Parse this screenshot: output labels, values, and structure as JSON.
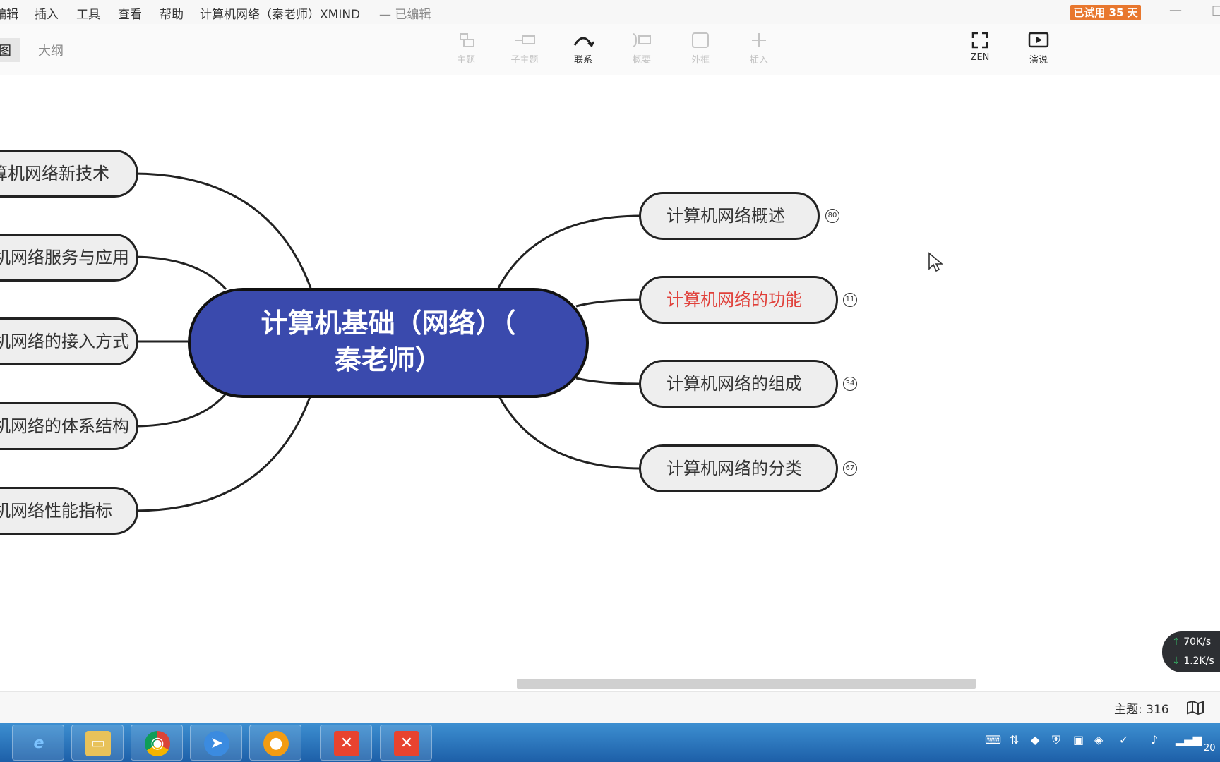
{
  "menubar": {
    "items": [
      "编辑",
      "插入",
      "工具",
      "查看",
      "帮助"
    ],
    "title": "计算机网络（秦老师）XMIND",
    "edited": "— 已编辑",
    "trial_badge": "已试用 35 天",
    "minimize": "—",
    "maximize": "□"
  },
  "toolbar": {
    "view_tabs": [
      "图",
      "大纲"
    ],
    "tools": [
      {
        "label": "主题",
        "icon": "topic-icon",
        "enabled": false
      },
      {
        "label": "子主题",
        "icon": "subtopic-icon",
        "enabled": false
      },
      {
        "label": "联系",
        "icon": "relationship-icon",
        "enabled": true
      },
      {
        "label": "概要",
        "icon": "summary-icon",
        "enabled": false
      },
      {
        "label": "外框",
        "icon": "boundary-icon",
        "enabled": false
      },
      {
        "label": "插入",
        "icon": "insert-plus-icon",
        "enabled": false
      }
    ],
    "right_tools": [
      {
        "label": "ZEN",
        "icon": "fullscreen-icon"
      },
      {
        "label": "演说",
        "icon": "present-icon"
      }
    ]
  },
  "mindmap": {
    "central": {
      "line1": "计算机基础（网络）（",
      "line2": "秦老师）",
      "color": "#3a4aad"
    },
    "left_topics": [
      "计算机网络新技术",
      "计算机网络服务与应用",
      "计算机网络的接入方式",
      "计算机网络的体系结构",
      "计算机网络性能指标"
    ],
    "right_topics": [
      {
        "label": "计算机网络概述",
        "count": "80",
        "color": "#333333"
      },
      {
        "label": "计算机网络的功能",
        "count": "11",
        "color": "#e0403a"
      },
      {
        "label": "计算机网络的组成",
        "count": "34",
        "color": "#333333"
      },
      {
        "label": "计算机网络的分类",
        "count": "67",
        "color": "#333333"
      }
    ]
  },
  "status": {
    "topic_count": "主题: 316"
  },
  "netmon": {
    "up": "70K/s",
    "down": "1.2K/s"
  },
  "taskbar": {
    "apps": [
      {
        "name": "ie-icon",
        "glyph": "e",
        "color": "#2a86d8"
      },
      {
        "name": "file-explorer-icon",
        "glyph": "▭",
        "color": "#e8c25a"
      },
      {
        "name": "chrome-icon",
        "glyph": "◉",
        "color": "#dd4b39"
      },
      {
        "name": "feishu-icon",
        "glyph": "➤",
        "color": "#3b8be0"
      },
      {
        "name": "record-icon",
        "glyph": "●",
        "color": "#f39c12"
      },
      {
        "name": "xmind-icon-1",
        "glyph": "✕",
        "color": "#e8432f"
      },
      {
        "name": "xmind-icon-2",
        "glyph": "✕",
        "color": "#e8432f"
      }
    ],
    "clock_date": "20"
  }
}
